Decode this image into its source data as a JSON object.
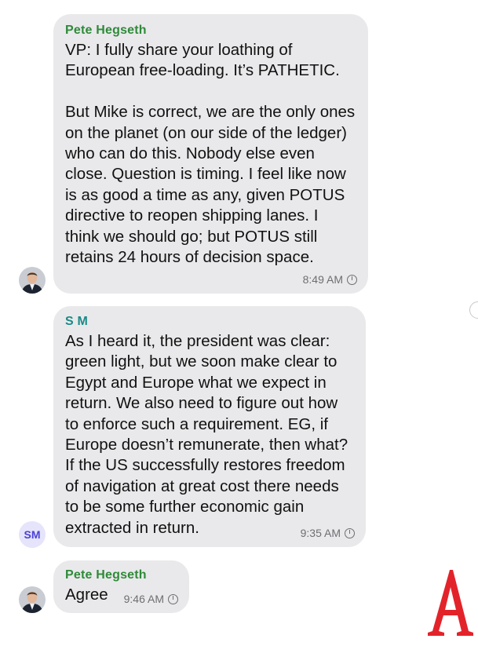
{
  "messages": [
    {
      "sender": "Pete Hegseth",
      "sender_color": "#2f8a3a",
      "text": "VP: I fully share your loathing of\nEuropean free-loading. It’s PATHETIC.\n\nBut Mike is correct, we are the only ones\non the planet (on our side of the ledger)\nwho can do this. Nobody else even\nclose. Question is timing. I feel like now\nis as good a time as any, given POTUS\ndirective to reopen shipping lanes. I\nthink we should go; but POTUS still\nretains 24 hours of decision space.",
      "time": "8:49 AM",
      "avatar": "photo"
    },
    {
      "sender": "S M",
      "sender_color": "#1a8a86",
      "text": "As I heard it, the president was clear:\ngreen light, but we soon make clear to\nEgypt and Europe what we expect in\nreturn. We also need to figure out how\nto enforce such a requirement. EG, if\nEurope doesn’t remunerate, then what?\nIf the US successfully restores freedom\nof navigation at great cost there needs\nto be some further economic gain\nextracted in return.",
      "time": "9:35 AM",
      "avatar_initials": "SM"
    },
    {
      "sender": "Pete Hegseth",
      "sender_color": "#2f8a3a",
      "text": "Agree",
      "time": "9:46 AM",
      "avatar": "photo"
    }
  ],
  "logo": {
    "letter": "A",
    "color": "#e3232a"
  }
}
